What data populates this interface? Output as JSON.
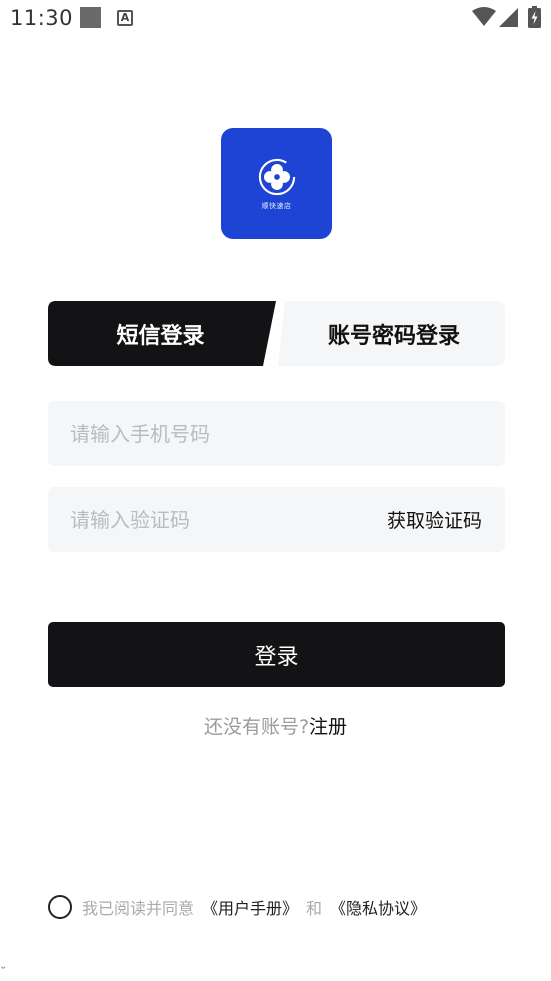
{
  "status_bar": {
    "time": "11:30",
    "icons": [
      "notification-square-icon",
      "text-a-icon",
      "wifi-icon",
      "signal-icon",
      "battery-icon"
    ]
  },
  "logo": {
    "text": "顺快速店",
    "icon": "clover-logo-icon",
    "bg_color": "#1e44d6"
  },
  "tabs": [
    {
      "label": "短信登录",
      "active": true
    },
    {
      "label": "账号密码登录",
      "active": false
    }
  ],
  "form": {
    "phone_placeholder": "请输入手机号码",
    "phone_value": "",
    "code_placeholder": "请输入验证码",
    "code_value": "",
    "get_code_label": "获取验证码"
  },
  "login_button": "登录",
  "register": {
    "prompt": "还没有账号?",
    "link": "注册"
  },
  "agreement": {
    "checked": false,
    "prefix": "我已阅读并同意",
    "user_manual": "《用户手册》",
    "and": "和",
    "privacy": "《隐私协议》"
  },
  "colors": {
    "primary_dark": "#131315",
    "field_bg": "#f5f6f8",
    "inactive_tab_bg": "#f5f6f8",
    "muted_text": "#9a9ca0"
  }
}
